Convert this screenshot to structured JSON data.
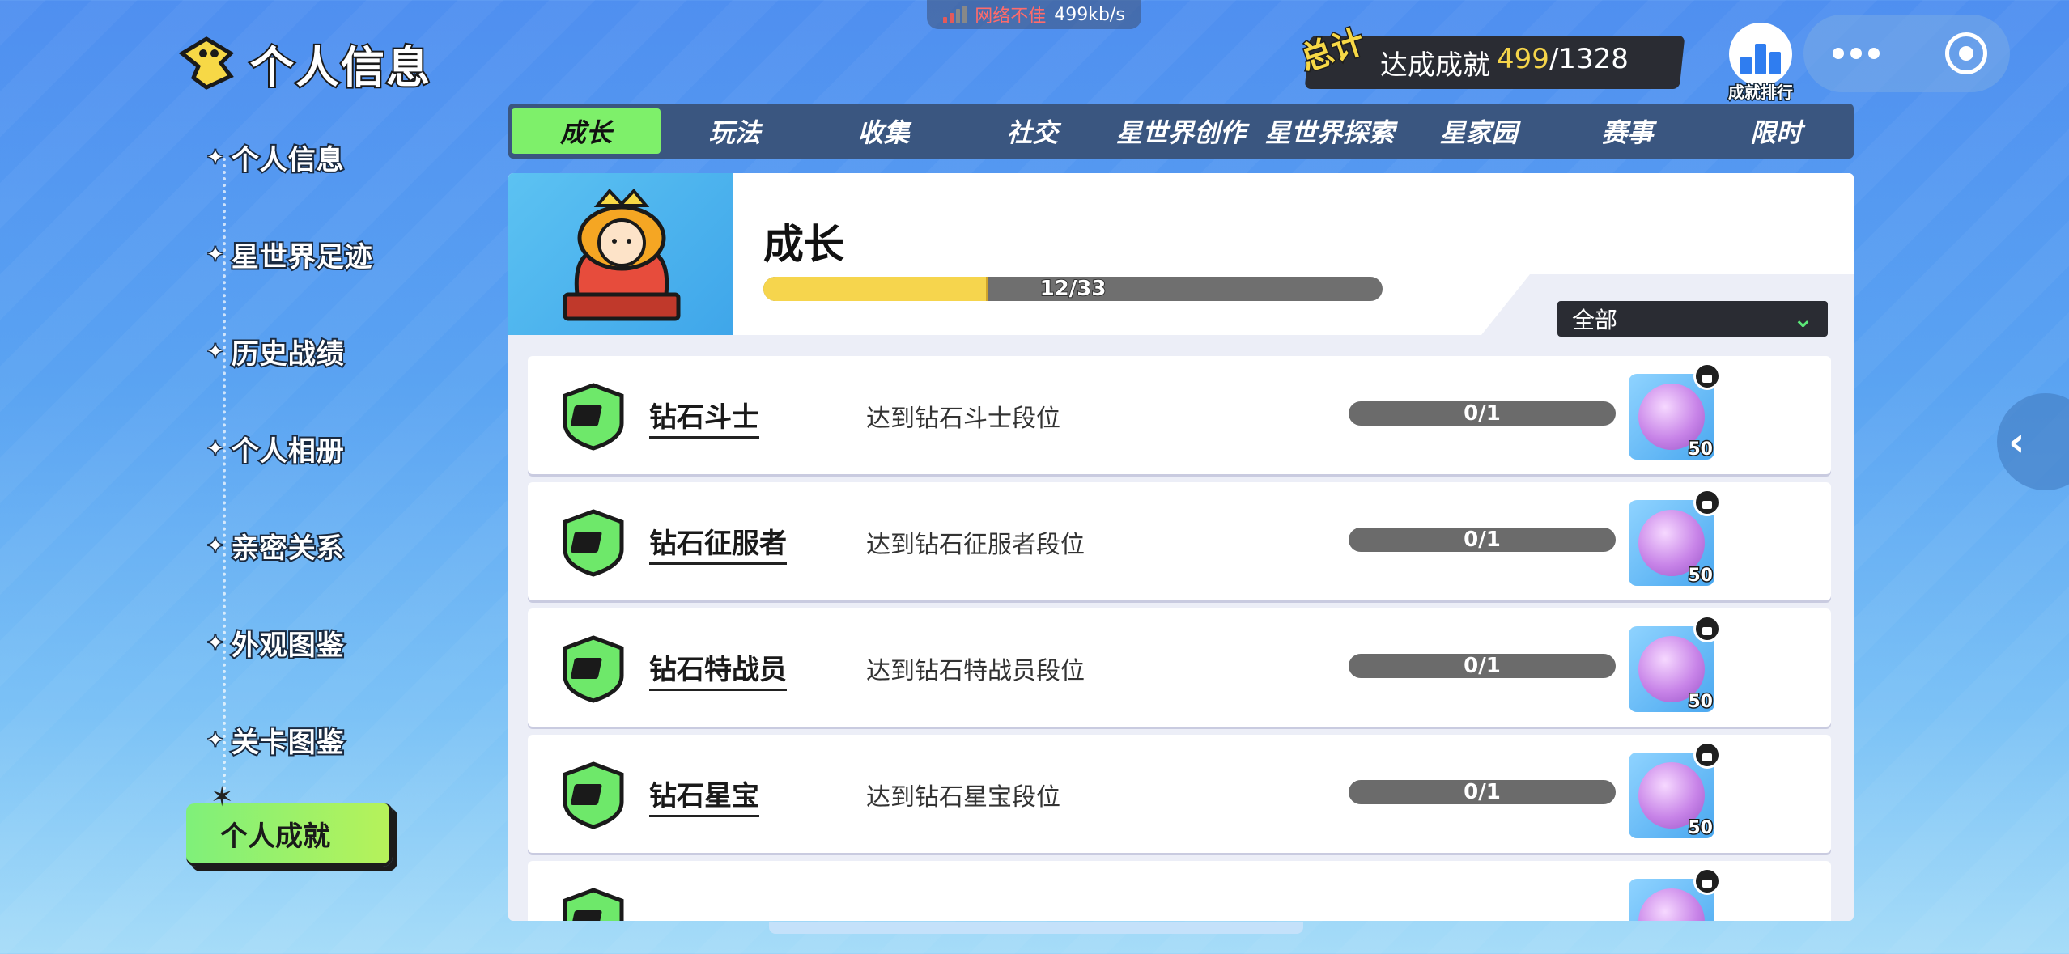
{
  "status": {
    "network_text": "网络不佳",
    "speed": "499kb/s"
  },
  "header": {
    "title": "个人信息"
  },
  "summary": {
    "tag": "总计",
    "label": "达成成就",
    "current": "499",
    "total": "/1328"
  },
  "rank_button": {
    "label": "成就排行"
  },
  "side_nav": {
    "items": [
      {
        "label": "个人信息"
      },
      {
        "label": "星世界足迹"
      },
      {
        "label": "历史战绩"
      },
      {
        "label": "个人相册"
      },
      {
        "label": "亲密关系"
      },
      {
        "label": "外观图鉴"
      },
      {
        "label": "关卡图鉴"
      }
    ],
    "active": {
      "label": "个人成就"
    }
  },
  "tabs": [
    {
      "label": "成长",
      "active": true
    },
    {
      "label": "玩法"
    },
    {
      "label": "收集"
    },
    {
      "label": "社交"
    },
    {
      "label": "星世界创作"
    },
    {
      "label": "星世界探索"
    },
    {
      "label": "星家园"
    },
    {
      "label": "赛事"
    },
    {
      "label": "限时"
    }
  ],
  "category": {
    "title": "成长",
    "progress_text": "12/33",
    "progress_value": 0.364
  },
  "filter": {
    "selected": "全部"
  },
  "achievements": [
    {
      "name": "钻石斗士",
      "desc": "达到钻石斗士段位",
      "progress": "0/1",
      "reward": "50"
    },
    {
      "name": "钻石征服者",
      "desc": "达到钻石征服者段位",
      "progress": "0/1",
      "reward": "50"
    },
    {
      "name": "钻石特战员",
      "desc": "达到钻石特战员段位",
      "progress": "0/1",
      "reward": "50"
    },
    {
      "name": "钻石星宝",
      "desc": "达到钻石星宝段位",
      "progress": "0/1",
      "reward": "50"
    }
  ],
  "colors": {
    "accent_green": "#7ef06a",
    "progress_yellow": "#f6d54d",
    "tab_bar": "#3a5680"
  }
}
